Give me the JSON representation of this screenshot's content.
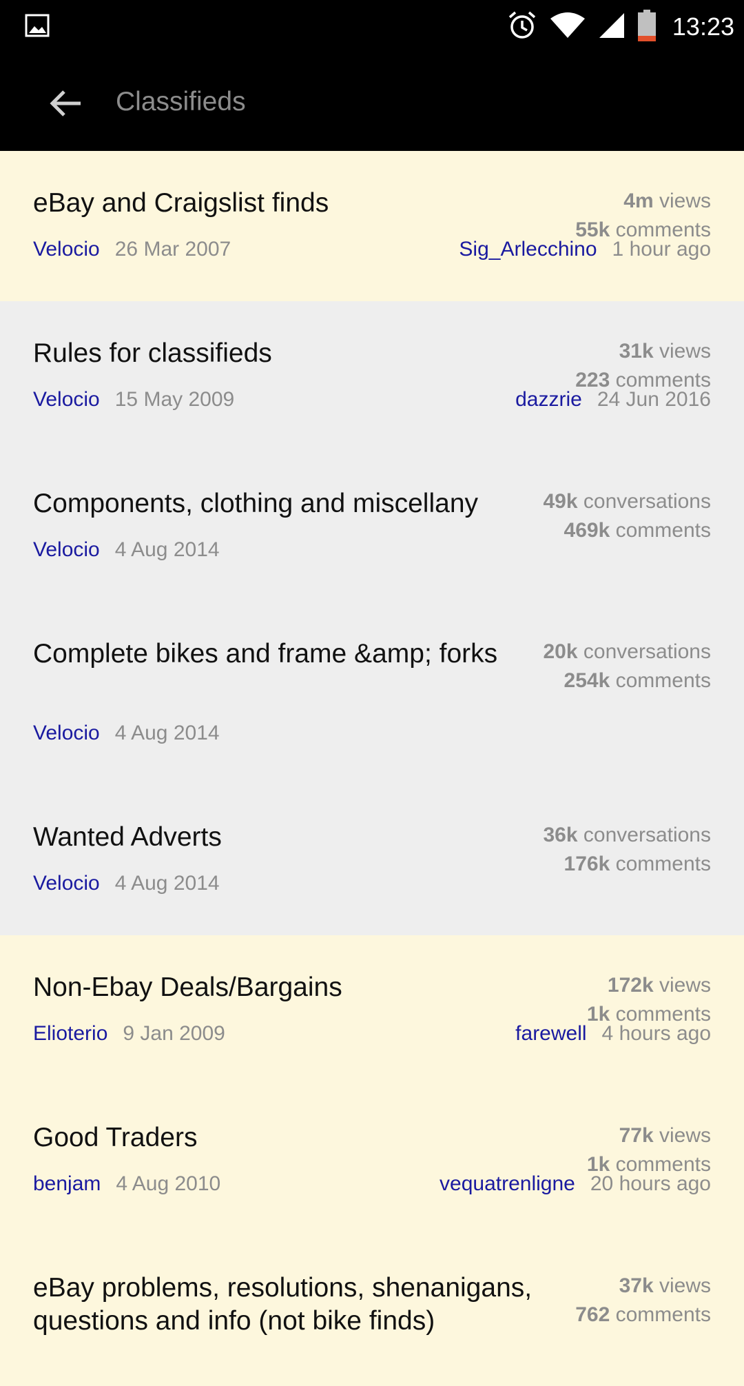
{
  "statusbar": {
    "time": "13:23"
  },
  "toolbar": {
    "title": "Classifieds"
  },
  "forums": [
    {
      "title": "eBay and Craigslist finds",
      "author": "Velocio",
      "date": "26 Mar 2007",
      "stat1_value": "4m",
      "stat1_label": " views",
      "stat2_value": "55k",
      "stat2_label": " comments",
      "last_author": "Sig_Arlecchino",
      "last_date": "1 hour ago"
    },
    {
      "title": "Rules for classifieds",
      "author": "Velocio",
      "date": "15 May 2009",
      "stat1_value": "31k",
      "stat1_label": " views",
      "stat2_value": "223",
      "stat2_label": " comments",
      "last_author": "dazzrie",
      "last_date": "24 Jun 2016"
    },
    {
      "title": "Components, clothing and miscellany",
      "author": "Velocio",
      "date": "4 Aug 2014",
      "stat1_value": "49k",
      "stat1_label": " conversations",
      "stat2_value": "469k",
      "stat2_label": " comments"
    },
    {
      "title": "Complete bikes and frame &amp; forks",
      "author": "Velocio",
      "date": "4 Aug 2014",
      "stat1_value": "20k",
      "stat1_label": " conversations",
      "stat2_value": "254k",
      "stat2_label": " comments"
    },
    {
      "title": "Wanted Adverts",
      "author": "Velocio",
      "date": "4 Aug 2014",
      "stat1_value": "36k",
      "stat1_label": " conversations",
      "stat2_value": "176k",
      "stat2_label": " comments"
    },
    {
      "title": "Non-Ebay Deals/Bargains",
      "author": "Elioterio",
      "date": "9 Jan 2009",
      "stat1_value": "172k",
      "stat1_label": " views",
      "stat2_value": "1k",
      "stat2_label": " comments",
      "last_author": "farewell",
      "last_date": "4 hours ago"
    },
    {
      "title": "Good Traders",
      "author": "benjam",
      "date": "4 Aug 2010",
      "stat1_value": "77k",
      "stat1_label": " views",
      "stat2_value": "1k",
      "stat2_label": " comments",
      "last_author": "vequatrenligne",
      "last_date": "20 hours ago"
    },
    {
      "title": "eBay problems, resolutions, shenanigans, questions and info (not bike finds)",
      "author": "",
      "date": "",
      "stat1_value": "37k",
      "stat1_label": " views",
      "stat2_value": "762",
      "stat2_label": " comments"
    }
  ]
}
